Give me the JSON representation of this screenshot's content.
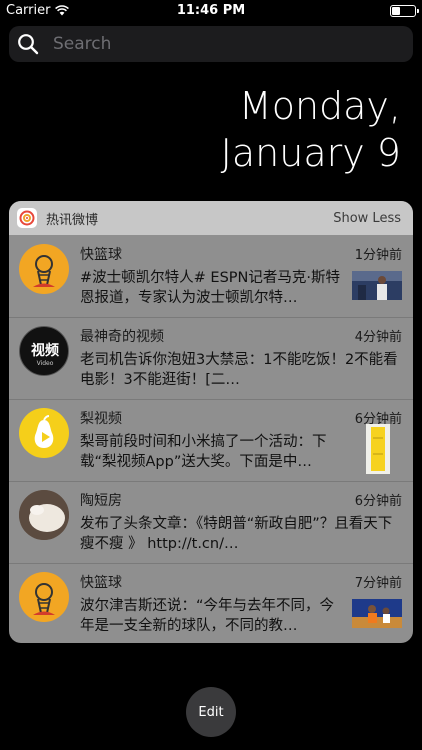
{
  "status_bar": {
    "carrier": "Carrier",
    "time": "11:46 PM"
  },
  "search": {
    "placeholder": "Search"
  },
  "date": {
    "line1": "Monday,",
    "line2": "January 9"
  },
  "widget": {
    "title": "热讯微博",
    "toggle_label": "Show Less",
    "items": [
      {
        "name": "快篮球",
        "time": "1分钟前",
        "text": "#波士顿凯尔特人# ESPN记者马克·斯特恩报道，专家认为波士顿凯尔特…"
      },
      {
        "name": "最神奇的视频",
        "time": "4分钟前",
        "text": "老司机告诉你泡妞3大禁忌：1不能吃饭！2不能看电影！3不能逛街！[二…",
        "avatar_text": "视频",
        "avatar_sub": "Video"
      },
      {
        "name": "梨视频",
        "time": "6分钟前",
        "text": "梨哥前段时间和小米搞了一个活动：下载“梨视频App”送大奖。下面是中…"
      },
      {
        "name": "陶短房",
        "time": "6分钟前",
        "text": "发布了头条文章：《特朗普“新政自肥”？且看天下瘦不瘦 》 http://t.cn/…"
      },
      {
        "name": "快篮球",
        "time": "7分钟前",
        "text": "波尔津吉斯还说：“今年与去年不同，今年是一支全新的球队，不同的教…"
      }
    ]
  },
  "edit_button": {
    "label": "Edit"
  },
  "colors": {
    "background": "#000000",
    "widget_body": "#8f8f8f",
    "widget_header": "#c7c7c7",
    "basketball_avatar": "#f2a623",
    "pear_avatar": "#f5cf1a"
  }
}
